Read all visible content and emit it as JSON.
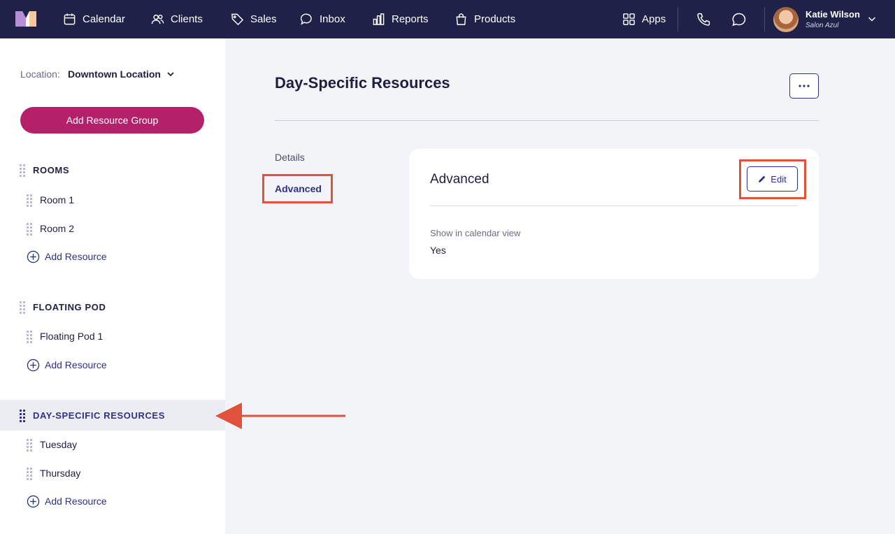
{
  "nav": {
    "items": [
      {
        "label": "Calendar",
        "icon": "calendar-icon"
      },
      {
        "label": "Clients",
        "icon": "users-icon"
      },
      {
        "label": "Sales",
        "icon": "tag-icon"
      },
      {
        "label": "Inbox",
        "icon": "chat-bubble-icon"
      },
      {
        "label": "Reports",
        "icon": "bar-chart-icon"
      },
      {
        "label": "Products",
        "icon": "shopping-bag-icon"
      }
    ],
    "apps_label": "Apps",
    "user": {
      "name": "Katie Wilson",
      "business": "Salon Azul"
    }
  },
  "sidebar": {
    "location_label": "Location:",
    "location_value": "Downtown Location",
    "add_group_label": "Add Resource Group",
    "groups": [
      {
        "title": "ROOMS",
        "resources": [
          "Room 1",
          "Room 2"
        ],
        "add_label": "Add Resource"
      },
      {
        "title": "FLOATING POD",
        "resources": [
          "Floating Pod 1"
        ],
        "add_label": "Add Resource"
      },
      {
        "title": "DAY-SPECIFIC RESOURCES",
        "resources": [
          "Tuesday",
          "Thursday"
        ],
        "add_label": "Add Resource",
        "active": true
      }
    ]
  },
  "main": {
    "title": "Day-Specific Resources",
    "tabs": [
      {
        "label": "Details"
      },
      {
        "label": "Advanced",
        "active": true
      }
    ],
    "card": {
      "title": "Advanced",
      "edit_label": "Edit",
      "field_label": "Show in calendar view",
      "field_value": "Yes"
    }
  },
  "colors": {
    "nav_bg": "#1f2148",
    "accent": "#2d3189",
    "primary_button": "#b5206a",
    "highlight": "#e0523c"
  }
}
